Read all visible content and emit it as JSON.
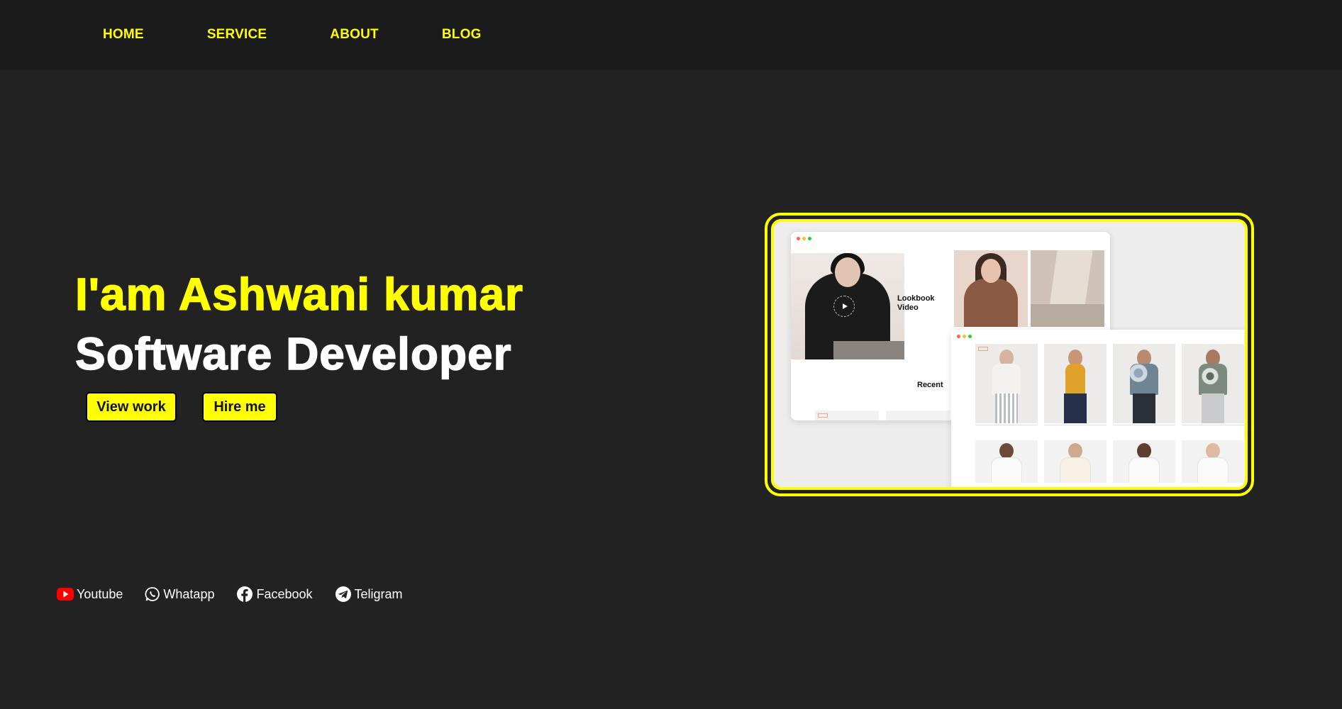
{
  "nav": {
    "items": [
      "HOME",
      "SERVICE",
      "ABOUT",
      "BLOG"
    ]
  },
  "hero": {
    "title": "I'am Ashwani kumar",
    "subtitle": "Software Developer",
    "buttons": {
      "view_work": "View work",
      "hire_me": "Hire me"
    }
  },
  "social": {
    "items": [
      {
        "label": "Youtube",
        "icon": "youtube-icon"
      },
      {
        "label": "Whatapp",
        "icon": "whatsapp-icon"
      },
      {
        "label": "Facebook",
        "icon": "facebook-icon"
      },
      {
        "label": "Teligram",
        "icon": "telegram-icon"
      }
    ]
  },
  "colors": {
    "accent": "#ffff00",
    "background": "#222222",
    "nav_background": "#1a1a1a",
    "youtube": "#ff0000"
  },
  "showcase": {
    "lookbook_title": "Lookbook Video",
    "recent_title": "Recent"
  }
}
